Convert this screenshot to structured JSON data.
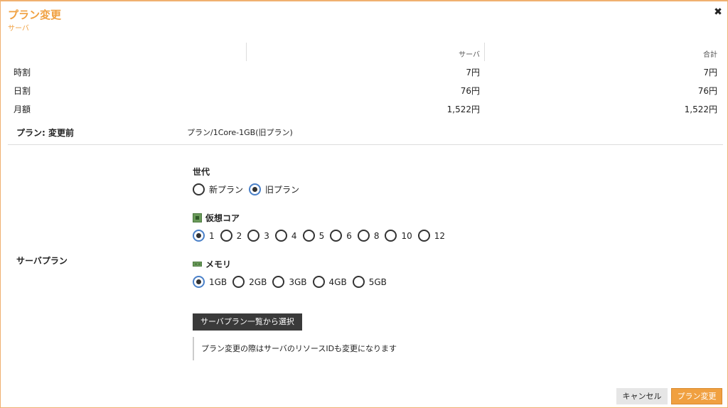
{
  "dialog": {
    "title": "プラン変更",
    "subtitle": "サーバ",
    "close_icon": "✖"
  },
  "price_table": {
    "headers": [
      "サーバ",
      "合計"
    ],
    "rows": [
      {
        "label": "時割",
        "server": "7円",
        "total": "7円"
      },
      {
        "label": "日割",
        "server": "76円",
        "total": "76円"
      },
      {
        "label": "月額",
        "server": "1,522円",
        "total": "1,522円"
      }
    ]
  },
  "plan_before": {
    "label": "プラン: 変更前",
    "value": "プラン/1Core-1GB(旧プラン)"
  },
  "server_plan": {
    "label": "サーバプラン",
    "generation": {
      "title": "世代",
      "options": [
        "新プラン",
        "旧プラン"
      ],
      "selected": "旧プラン"
    },
    "cores": {
      "title": "仮想コア",
      "icon": "cpu-chip-icon",
      "options": [
        "1",
        "2",
        "3",
        "4",
        "5",
        "6",
        "8",
        "10",
        "12"
      ],
      "selected": "1"
    },
    "memory": {
      "title": "メモリ",
      "icon": "memory-stick-icon",
      "options": [
        "1GB",
        "2GB",
        "3GB",
        "4GB",
        "5GB"
      ],
      "selected": "1GB"
    },
    "list_button": "サーバプラン一覧から選択",
    "note": "プラン変更の際はサーバのリソースIDも変更になります"
  },
  "footer": {
    "cancel": "キャンセル",
    "submit": "プラン変更"
  },
  "colors": {
    "accent": "#f0a040",
    "dark_button": "#3a3a3a",
    "radio_selected_border": "#4a80c8"
  }
}
